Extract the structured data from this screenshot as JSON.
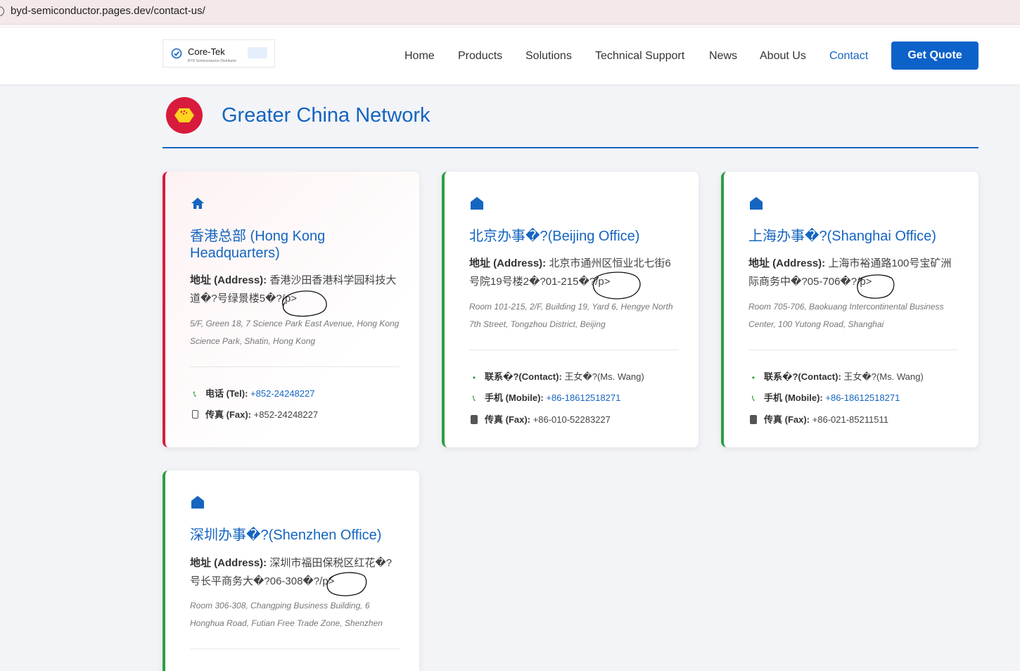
{
  "browser": {
    "url": "byd-semiconductor.pages.dev/contact-us/"
  },
  "header": {
    "logo": {
      "brand": "Core-Tek",
      "tagline": "BYD Semiconductor Distributor"
    },
    "nav": [
      {
        "label": "Home",
        "active": false
      },
      {
        "label": "Products",
        "active": false
      },
      {
        "label": "Solutions",
        "active": false
      },
      {
        "label": "Technical Support",
        "active": false
      },
      {
        "label": "News",
        "active": false
      },
      {
        "label": "About Us",
        "active": false
      },
      {
        "label": "Contact",
        "active": true
      }
    ],
    "cta": "Get Quote"
  },
  "section": {
    "title": "Greater China Network",
    "icon": "china-flag-icon"
  },
  "colors": {
    "brand_blue": "#1565c0",
    "hq_accent": "#d81b3c",
    "branch_accent": "#2e9e44",
    "button": "#0d62c9"
  },
  "offices": [
    {
      "title": "香港总部 (Hong Kong Headquarters)",
      "address_label": "地址 (Address):",
      "address_cn": "香港沙田香港科学园科技大道�?号绿景楼5�?/p>",
      "address_en": "5/F, Green 18, 7 Science Park East Avenue, Hong Kong Science Park, Shatin, Hong Kong",
      "tel_label": "电话 (Tel):",
      "tel": "+852-24248227",
      "fax_label": "传真 (Fax):",
      "fax": "+852-24248227"
    },
    {
      "title": "北京办事�?(Beijing Office)",
      "address_label": "地址 (Address):",
      "address_cn": "北京市通州区恒业北七街6号院19号楼2�?01-215�?/p>",
      "address_en": "Room 101-215, 2/F, Building 19, Yard 6, Hengye North 7th Street, Tongzhou District, Beijing",
      "contact_label": "联系�?(Contact):",
      "contact": "王女�?(Ms. Wang)",
      "mobile_label": "手机 (Mobile):",
      "mobile": "+86-18612518271",
      "fax_label": "传真 (Fax):",
      "fax": "+86-010-52283227"
    },
    {
      "title": "上海办事�?(Shanghai Office)",
      "address_label": "地址 (Address):",
      "address_cn": "上海市裕通路100号宝矿洲际商务中�?05-706�?/p>",
      "address_en": "Room 705-706, Baokuang Intercontinental Business Center, 100 Yutong Road, Shanghai",
      "contact_label": "联系�?(Contact):",
      "contact": "王女�?(Ms. Wang)",
      "mobile_label": "手机 (Mobile):",
      "mobile": "+86-18612518271",
      "fax_label": "传真 (Fax):",
      "fax": "+86-021-85211511"
    },
    {
      "title": "深圳办事�?(Shenzhen Office)",
      "address_label": "地址 (Address):",
      "address_cn": "深圳市福田保税区红花�?号长平商务大�?06-308�?/p>",
      "address_en": "Room 306-308, Changping Business Building, 6 Honghua Road, Futian Free Trade Zone, Shenzhen"
    }
  ]
}
